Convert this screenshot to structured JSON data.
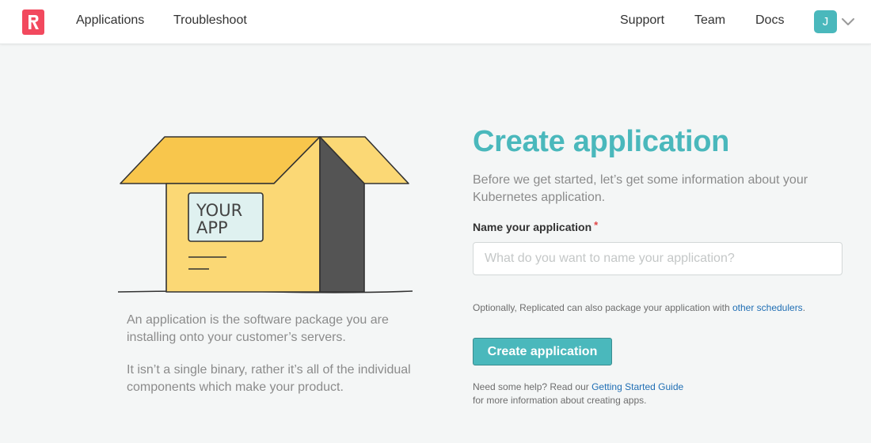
{
  "header": {
    "logo_letter": "R",
    "nav_left": [
      "Applications",
      "Troubleshoot"
    ],
    "nav_right": [
      "Support",
      "Team",
      "Docs"
    ],
    "user_initial": "J"
  },
  "illustration": {
    "box_text_line1": "YOUR",
    "box_text_line2": "APP"
  },
  "left": {
    "paragraph1": "An application is the software package you are installing onto your customer’s servers.",
    "paragraph2": "It isn’t a single binary, rather it’s all of the individual components which make your product."
  },
  "form": {
    "title": "Create application",
    "intro": "Before we get started, let’s get some information about your Kubernetes application.",
    "name_label": "Name your application",
    "required_mark": "*",
    "name_value": "",
    "name_placeholder": "What do you want to name your application?",
    "optional_text": "Optionally, Replicated can also package your application with ",
    "optional_link": "other schedulers",
    "optional_suffix": ".",
    "submit_label": "Create application",
    "help_prefix": "Need some help? Read our ",
    "help_link": "Getting Started Guide",
    "help_suffix": "for more information about creating apps."
  },
  "colors": {
    "accent": "#4ab8bc",
    "brand": "#f2495e",
    "link": "#1f6eb4",
    "box_front": "#fbd875",
    "box_top": "#f8c64c",
    "box_side": "#545454"
  }
}
